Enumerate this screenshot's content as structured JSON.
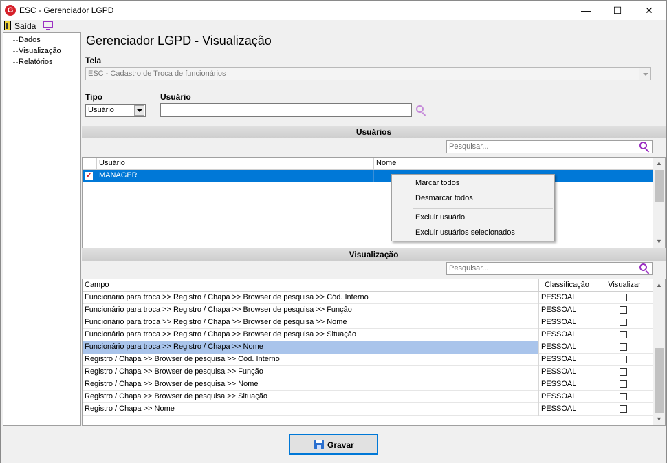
{
  "window": {
    "app_icon": "G",
    "title": "ESC - Gerenciador LGPD",
    "minimize": "—",
    "maximize": "☐",
    "close": "✕"
  },
  "toolbar": {
    "exit_label": "Saída"
  },
  "tree": {
    "items": [
      "Dados",
      "Visualização",
      "Relatórios"
    ]
  },
  "page_title": "Gerenciador LGPD - Visualização",
  "tela": {
    "label": "Tela",
    "value": "ESC - Cadastro de Troca de funcionários"
  },
  "tipo": {
    "label": "Tipo",
    "value": "Usuário"
  },
  "usuario": {
    "label": "Usuário",
    "value": ""
  },
  "usuarios_section": {
    "title": "Usuários",
    "search_placeholder": "Pesquisar...",
    "columns": [
      "Usuário",
      "Nome"
    ],
    "rows": [
      {
        "checked": true,
        "usuario": "MANAGER",
        "nome": ""
      }
    ]
  },
  "context_menu": {
    "items": [
      "Marcar todos",
      "Desmarcar todos",
      "Excluir usuário",
      "Excluir usuários selecionados"
    ]
  },
  "visualizacao_section": {
    "title": "Visualização",
    "search_placeholder": "Pesquisar...",
    "columns": [
      "Campo",
      "Classificação",
      "Visualizar"
    ],
    "rows": [
      {
        "campo": "Funcionário para troca >> Registro / Chapa >> Browser de pesquisa >> Cód. Interno",
        "classificacao": "PESSOAL",
        "visualizar": false
      },
      {
        "campo": "Funcionário para troca >> Registro / Chapa >> Browser de pesquisa >> Função",
        "classificacao": "PESSOAL",
        "visualizar": false
      },
      {
        "campo": "Funcionário para troca >> Registro / Chapa >> Browser de pesquisa >> Nome",
        "classificacao": "PESSOAL",
        "visualizar": false
      },
      {
        "campo": "Funcionário para troca >> Registro / Chapa >> Browser de pesquisa >> Situação",
        "classificacao": "PESSOAL",
        "visualizar": false
      },
      {
        "campo": "Funcionário para troca >> Registro / Chapa >> Nome",
        "classificacao": "PESSOAL",
        "visualizar": false,
        "highlighted": true
      },
      {
        "campo": "Registro / Chapa >> Browser de pesquisa >> Cód. Interno",
        "classificacao": "PESSOAL",
        "visualizar": false
      },
      {
        "campo": "Registro / Chapa >> Browser de pesquisa >> Função",
        "classificacao": "PESSOAL",
        "visualizar": false
      },
      {
        "campo": "Registro / Chapa >> Browser de pesquisa >> Nome",
        "classificacao": "PESSOAL",
        "visualizar": false
      },
      {
        "campo": "Registro / Chapa >> Browser de pesquisa >> Situação",
        "classificacao": "PESSOAL",
        "visualizar": false
      },
      {
        "campo": "Registro / Chapa >> Nome",
        "classificacao": "PESSOAL",
        "visualizar": false
      }
    ]
  },
  "save_button": {
    "label": "Gravar"
  },
  "colors": {
    "accent": "#0078d7",
    "icon_purple": "#9b2fc2",
    "brand_red": "#d6202a",
    "row_highlight": "#a9c4eb"
  }
}
